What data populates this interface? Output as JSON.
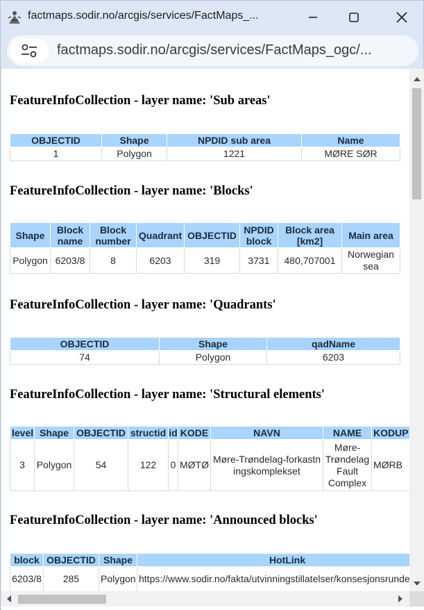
{
  "window": {
    "title": "factmaps.sodir.no/arcgis/services/FactMaps_..."
  },
  "addressbar": {
    "url": "factmaps.sodir.no/arcgis/services/FactMaps_ogc/..."
  },
  "sections": {
    "sub_areas": {
      "title": "FeatureInfoCollection - layer name: 'Sub areas'",
      "headers": [
        "OBJECTID",
        "Shape",
        "NPDID sub area",
        "Name"
      ],
      "row": [
        "1",
        "Polygon",
        "1221",
        "MØRE SØR"
      ]
    },
    "blocks": {
      "title": "FeatureInfoCollection - layer name: 'Blocks'",
      "headers": [
        "Shape",
        "Block name",
        "Block number",
        "Quadrant",
        "OBJECTID",
        "NPDID block",
        "Block area [km2]",
        "Main area"
      ],
      "row": [
        "Polygon",
        "6203/8",
        "8",
        "6203",
        "319",
        "3731",
        "480,707001",
        "Norwegian sea"
      ]
    },
    "quadrants": {
      "title": "FeatureInfoCollection - layer name: 'Quadrants'",
      "headers": [
        "OBJECTID",
        "Shape",
        "qadName"
      ],
      "row": [
        "74",
        "Polygon",
        "6203"
      ]
    },
    "structural": {
      "title": "FeatureInfoCollection - layer name: 'Structural elements'",
      "headers": [
        "level",
        "Shape",
        "OBJECTID",
        "structid",
        "id",
        "KODE",
        "NAVN",
        "NAME",
        "KODUP"
      ],
      "row": [
        "3",
        "Polygon",
        "54",
        "122",
        "0",
        "MØTØ",
        "Møre-Trøndelag-forkastningskomplekset",
        "Møre-Trøndelag Fault Complex",
        "MØRB"
      ]
    },
    "announced": {
      "title": "FeatureInfoCollection - layer name: 'Announced blocks'",
      "headers": [
        "block",
        "OBJECTID",
        "Shape",
        "HotLink"
      ],
      "row": [
        "6203/8",
        "285",
        "Polygon",
        "https://www.sodir.no/fakta/utvinningstillatelser/konsesjonsrunder"
      ]
    }
  }
}
